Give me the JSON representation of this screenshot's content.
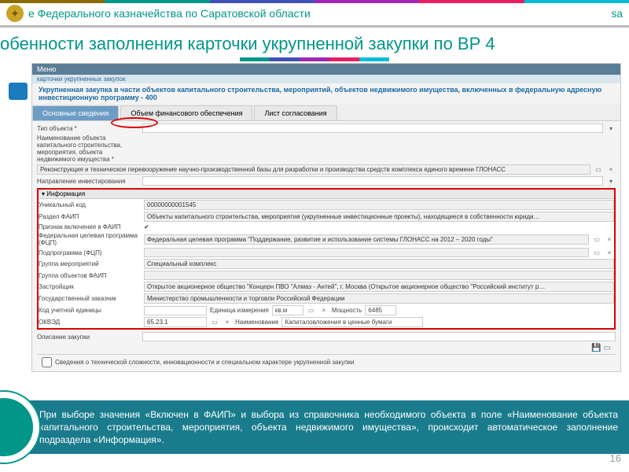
{
  "header": {
    "org": "е Федерального казначейства по Саратовской области",
    "site_fragment": "sa"
  },
  "slide": {
    "title": "обенности заполнения карточки укрупненной закупки по ВР 4"
  },
  "screenshot": {
    "menu": "Меню",
    "crumb": "карточки укрупненных закупок",
    "doc_title": "Укрупненная закупка в части объектов капитального строительства, мероприятий, объектов недвижимого имущества, включенных в федеральную адресную инвестиционную программу - 400",
    "tabs": {
      "t1": "Основные сведения",
      "t2": "Объем финансового обеспечения",
      "t3": "Лист согласования"
    },
    "fields": {
      "type_label": "Тип объекта *",
      "name_label": "Наименование объекта капитального строительства, мероприятия, объекта недвижимого имущества *",
      "name_value": "Реконструкция и техническое перевооружение научно-производственной базы для разработки и производства средств комплекса единого времени ГЛОНАСС",
      "direction_label": "Направление инвестирования"
    },
    "info": {
      "header": "Информация",
      "rows": {
        "unique_label": "Уникальный код",
        "unique_value": "00000000001545",
        "section_label": "Раздел ФАИП",
        "section_value": "Объекты капитального строительства, мероприятия (укрупненные инвестиционные проекты), находящиеся в собственности юриди…",
        "incl_label": "Признак включения в ФАИП",
        "incl_value": "✔",
        "ftp_label": "Федеральная целевая программа (ФЦП)",
        "ftp_value": "Федеральная целевая программа \"Поддержание, развитие и использование системы ГЛОНАСС на 2012 – 2020 годы\"",
        "sub_label": "Подпрограмма (ФЦП)",
        "grp_label": "Группа мероприятий",
        "grp_value": "Специальный комплекс",
        "objgrp_label": "Группа объектов ФАИП",
        "dev_label": "Застройщик",
        "dev_value": "Открытое акционерное общество \"Концерн ПВО \"Алмаз - Антей\", г. Москва (Открытое акционерное общество \"Российский институт р…",
        "client_label": "Государственный заказчик",
        "client_value": "Министерство промышленности и торговли Российской Федерации",
        "acct_label": "Код учетной единицы",
        "unit_label": "Единица измерения",
        "unit_value": "кв.м",
        "power_label": "Мощность",
        "power_value": "6485",
        "okved_label": "ОКВЭД",
        "okved_value": "65.23.1",
        "rename_label": "Наименование",
        "rename_value": "Капиталовложения в ценные бумаги"
      }
    },
    "desc_label": "Описание закупки",
    "checkbox_label": "Сведения о технической сложности, инновационности и специальном характере укрупненной закупки"
  },
  "callout": {
    "text": "При выборе значения «Включен в ФАИП» и выбора из справочника необходимого объекта в поле «Наименование объекта капитального строительства, мероприятия, объекта недвижимого имущества», происходит автоматическое заполнение подраздела «Информация»."
  },
  "page_number": "16"
}
